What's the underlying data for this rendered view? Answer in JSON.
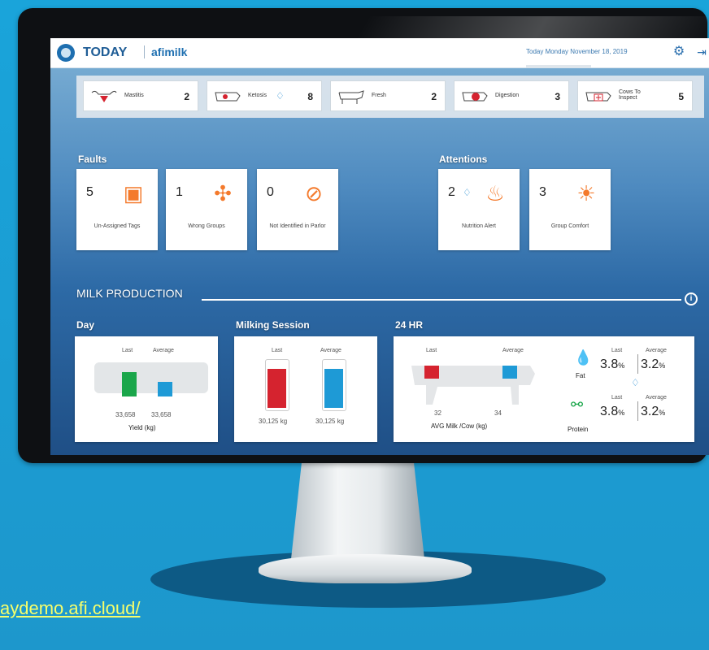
{
  "header": {
    "title": "TODAY",
    "brand": "afimilk",
    "date": "Today Monday November 18, 2019"
  },
  "status_strip": [
    {
      "label": "Mastitis",
      "count": "2"
    },
    {
      "label": "Ketosis",
      "count": "8"
    },
    {
      "label": "Fresh",
      "count": "2"
    },
    {
      "label": "Digestion",
      "count": "3"
    },
    {
      "label": "Cows To Inspect",
      "count": "5"
    }
  ],
  "faults": {
    "title": "Faults",
    "items": [
      {
        "count": "5",
        "label": "Un-Assigned Tags",
        "icon": "tag-icon"
      },
      {
        "count": "1",
        "label": "Wrong Groups",
        "icon": "cows-group-icon"
      },
      {
        "count": "0",
        "label": "Not Identified in Parlor",
        "icon": "no-signal-icon"
      }
    ]
  },
  "attentions": {
    "title": "Attentions",
    "items": [
      {
        "count": "2",
        "label": "Nutrition Alert",
        "icon": "flame-icon"
      },
      {
        "count": "3",
        "label": "Group Comfort",
        "icon": "comfort-icon"
      }
    ]
  },
  "milk_production": {
    "title": "MILK PRODUCTION",
    "day": {
      "title": "Day",
      "last_label": "Last",
      "avg_label": "Average",
      "last_value": "33,658",
      "avg_value": "33,658",
      "caption": "Yield (kg)"
    },
    "session": {
      "title": "Milking Session",
      "last_label": "Last",
      "avg_label": "Average",
      "last_value": "30,125",
      "avg_value": "30,125",
      "unit": "kg"
    },
    "hr24": {
      "title": "24 HR",
      "last_label": "Last",
      "avg_label": "Average",
      "last_value": "32",
      "avg_value": "34",
      "caption": "AVG Milk /Cow (kg)",
      "fat": {
        "label": "Fat",
        "last_label": "Last",
        "avg_label": "Average",
        "last": "3.8",
        "avg": "3.2",
        "unit": "%"
      },
      "protein": {
        "label": "Protein",
        "last_label": "Last",
        "avg_label": "Average",
        "last": "3.8",
        "avg": "3.2",
        "unit": "%"
      }
    }
  },
  "demo_link": "aydemo.afi.cloud/",
  "colors": {
    "accent": "#1e6fb0",
    "orange": "#f47a2c",
    "green": "#1aa64a",
    "blue": "#1e9ad6",
    "red": "#d5232f"
  }
}
